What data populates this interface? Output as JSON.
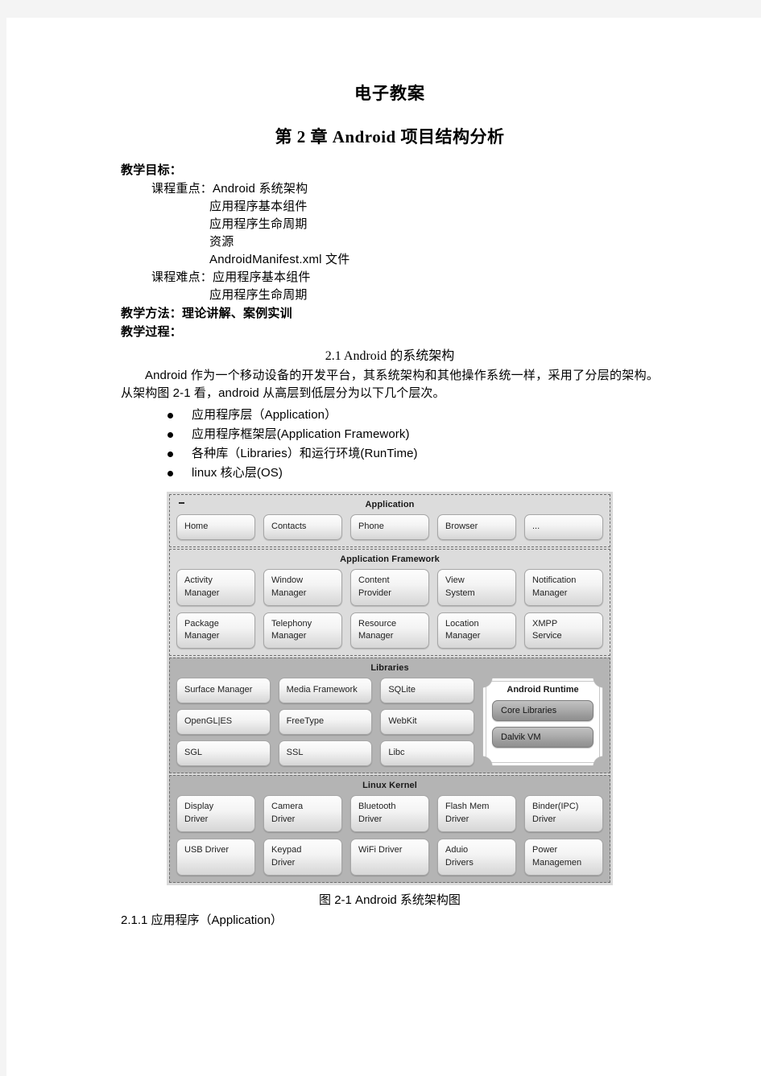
{
  "document": {
    "title": "电子教案",
    "chapter_title": "第 2 章 Android 项目结构分析"
  },
  "teaching": {
    "objectives_label": "教学目标：",
    "key_points_label": "课程重点：Android 系统架构",
    "key_points_extra": [
      "应用程序基本组件",
      "应用程序生命周期",
      "资源",
      "AndroidManifest.xml 文件"
    ],
    "difficult_points_label": "课程难点：应用程序基本组件",
    "difficult_points_extra": [
      "应用程序生命周期"
    ],
    "methods_label": "教学方法：理论讲解、案例实训",
    "process_label": "教学过程："
  },
  "section": {
    "heading": "2.1 Android 的系统架构",
    "paragraph": "Android 作为一个移动设备的开发平台，其系统架构和其他操作系统一样，采用了分层的架构。从架构图 2-1 看，android 从高层到低层分为以下几个层次。",
    "bullets": [
      "应用程序层（Application）",
      "应用程序框架层(Application Framework)",
      "各种库（Libraries）和运行环境(RunTime)",
      "linux 核心层(OS)"
    ],
    "figure_caption": "图 2-1 Android 系统架构图",
    "subsection": "2.1.1 应用程序（Application）"
  },
  "architecture": {
    "layers": [
      {
        "name": "Application",
        "rows": [
          [
            {
              "line1": "Home"
            },
            {
              "line1": "Contacts"
            },
            {
              "line1": "Phone"
            },
            {
              "line1": "Browser"
            },
            {
              "line1": "..."
            }
          ]
        ]
      },
      {
        "name": "Application Framework",
        "rows": [
          [
            {
              "line1": "Activity",
              "line2": "Manager"
            },
            {
              "line1": "Window",
              "line2": "Manager"
            },
            {
              "line1": "Content",
              "line2": "Provider"
            },
            {
              "line1": "View",
              "line2": "System"
            },
            {
              "line1": "Notification",
              "line2": "Manager"
            }
          ],
          [
            {
              "line1": "Package",
              "line2": "Manager"
            },
            {
              "line1": "Telephony",
              "line2": "Manager"
            },
            {
              "line1": "Resource",
              "line2": "Manager"
            },
            {
              "line1": "Location",
              "line2": "Manager"
            },
            {
              "line1": "XMPP",
              "line2": "Service"
            }
          ]
        ]
      },
      {
        "name": "Libraries",
        "rows": [
          [
            {
              "line1": "Surface Manager"
            },
            {
              "line1": "Media Framework"
            },
            {
              "line1": "SQLite"
            }
          ],
          [
            {
              "line1": "OpenGL|ES"
            },
            {
              "line1": "FreeType"
            },
            {
              "line1": "WebKit"
            }
          ],
          [
            {
              "line1": "SGL"
            },
            {
              "line1": "SSL"
            },
            {
              "line1": "Libc"
            }
          ]
        ]
      },
      {
        "name": "Linux Kernel",
        "rows": [
          [
            {
              "line1": "Display",
              "line2": "Driver"
            },
            {
              "line1": "Camera",
              "line2": "Driver"
            },
            {
              "line1": "Bluetooth",
              "line2": "Driver"
            },
            {
              "line1": "Flash Mem",
              "line2": "Driver"
            },
            {
              "line1": "Binder(IPC)",
              "line2": "Driver"
            }
          ],
          [
            {
              "line1": "USB Driver",
              "line2": ""
            },
            {
              "line1": "Keypad",
              "line2": "Driver"
            },
            {
              "line1": "WiFi Driver",
              "line2": ""
            },
            {
              "line1": "Aduio",
              "line2": "Drivers"
            },
            {
              "line1": "Power",
              "line2": "Managemen"
            }
          ]
        ]
      }
    ],
    "runtime": {
      "title": "Android Runtime",
      "items": [
        "Core Libraries",
        "Dalvik VM"
      ]
    }
  },
  "colors": {
    "page_background": "#f4f4f4",
    "page": "#ffffff",
    "diagram_frame": "#d9d9d9",
    "layer_light": "#dcdcdc",
    "layer_dark": "#b4b4b4",
    "text": "#000000"
  }
}
